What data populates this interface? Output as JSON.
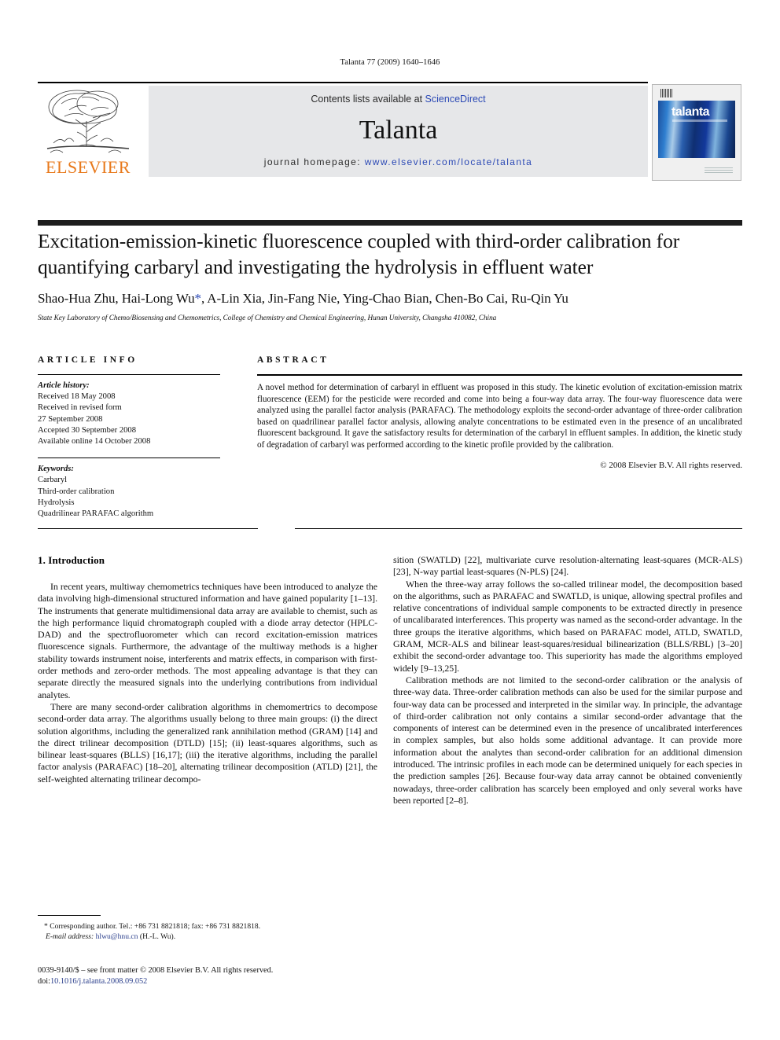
{
  "running_head": "Talanta 77 (2009) 1640–1646",
  "masthead": {
    "contents_prefix": "Contents lists available at ",
    "contents_link": "ScienceDirect",
    "journal_name": "Talanta",
    "homepage_prefix": "journal homepage: ",
    "homepage_link": "www.elsevier.com/locate/talanta",
    "publisher": "ELSEVIER",
    "cover_title": "talanta"
  },
  "article": {
    "title": "Excitation-emission-kinetic fluorescence coupled with third-order calibration for quantifying carbaryl and investigating the hydrolysis in effluent water",
    "authors": "Shao-Hua Zhu, Hai-Long Wu",
    "authors_rest": ", A-Lin Xia, Jin-Fang Nie, Ying-Chao Bian, Chen-Bo Cai, Ru-Qin Yu",
    "corresponding_marker": "*",
    "affiliation": "State Key Laboratory of Chemo/Biosensing and Chemometrics, College of Chemistry and Chemical Engineering, Hunan University, Changsha 410082, China"
  },
  "article_info": {
    "heading": "ARTICLE INFO",
    "history_label": "Article history:",
    "history": [
      "Received 18 May 2008",
      "Received in revised form",
      "27 September 2008",
      "Accepted 30 September 2008",
      "Available online 14 October 2008"
    ],
    "keywords_label": "Keywords:",
    "keywords": [
      "Carbaryl",
      "Third-order calibration",
      "Hydrolysis",
      "Quadrilinear PARAFAC algorithm"
    ]
  },
  "abstract": {
    "heading": "ABSTRACT",
    "text": "A novel method for determination of carbaryl in effluent was proposed in this study. The kinetic evolution of excitation-emission matrix fluorescence (EEM) for the pesticide were recorded and come into being a four-way data array. The four-way fluorescence data were analyzed using the parallel factor analysis (PARAFAC). The methodology exploits the second-order advantage of three-order calibration based on quadrilinear parallel factor analysis, allowing analyte concentrations to be estimated even in the presence of an uncalibrated fluorescent background. It gave the satisfactory results for determination of the carbaryl in effluent samples. In addition, the kinetic study of degradation of carbaryl was performed according to the kinetic profile provided by the calibration.",
    "copyright": "© 2008 Elsevier B.V. All rights reserved."
  },
  "body": {
    "section_number_title": "1. Introduction",
    "left_paragraphs": [
      "In recent years, multiway chemometrics techniques have been introduced to analyze the data involving high-dimensional structured information and have gained popularity [1–13]. The instruments that generate multidimensional data array are available to chemist, such as the high performance liquid chromatograph coupled with a diode array detector (HPLC-DAD) and the spectrofluorometer which can record excitation-emission matrices fluorescence signals. Furthermore, the advantage of the multiway methods is a higher stability towards instrument noise, interferents and matrix effects, in comparison with first-order methods and zero-order methods. The most appealing advantage is that they can separate directly the measured signals into the underlying contributions from individual analytes.",
      "There are many second-order calibration algorithms in chemomertrics to decompose second-order data array. The algorithms usually belong to three main groups: (i) the direct solution algorithms, including the generalized rank annihilation method (GRAM) [14] and the direct trilinear decomposition (DTLD) [15]; (ii) least-squares algorithms, such as bilinear least-squares (BLLS) [16,17]; (iii) the iterative algorithms, including the parallel factor analysis (PARAFAC) [18–20], alternating trilinear decomposition (ATLD) [21], the self-weighted alternating trilinear decompo-"
    ],
    "right_paragraphs": [
      "sition (SWATLD) [22], multivariate curve resolution-alternating least-squares (MCR-ALS) [23], N-way partial least-squares (N-PLS) [24].",
      "When the three-way array follows the so-called trilinear model, the decomposition based on the algorithms, such as PARAFAC and SWATLD, is unique, allowing spectral profiles and relative concentrations of individual sample components to be extracted directly in presence of uncalibarated interferences. This property was named as the second-order advantage. In the three groups the iterative algorithms, which based on PARAFAC model, ATLD, SWATLD, GRAM, MCR-ALS and bilinear least-squares/residual bilinearization (BLLS/RBL) [3–20] exhibit the second-order advantage too. This superiority has made the algorithms employed widely [9–13,25].",
      "Calibration methods are not limited to the second-order calibration or the analysis of three-way data. Three-order calibration methods can also be used for the similar purpose and four-way data can be processed and interpreted in the similar way. In principle, the advantage of third-order calibration not only contains a similar second-order advantage that the components of interest can be determined even in the presence of uncalibrated interferences in complex samples, but also holds some additional advantage. It can provide more information about the analytes than second-order calibration for an additional dimension introduced. The intrinsic profiles in each mode can be determined uniquely for each species in the prediction samples [26]. Because four-way data array cannot be obtained conveniently nowadays, three-order calibration has scarcely been employed and only several works have been reported [2–8]."
    ]
  },
  "footnote": {
    "marker": "*",
    "corresponding": "Corresponding author. Tel.: +86 731 8821818; fax: +86 731 8821818.",
    "email_label": "E-mail address:",
    "email": "hlwu@hnu.cn",
    "email_suffix": "(H.-L. Wu)."
  },
  "imprint": {
    "issn_line": "0039-9140/$ – see front matter © 2008 Elsevier B.V. All rights reserved.",
    "doi_label": "doi:",
    "doi": "10.1016/j.talanta.2008.09.052"
  },
  "colors": {
    "link": "#2b49b5",
    "reference": "#2b3f8c",
    "elsevier_orange": "#E8791B",
    "band_gray": "#e6e7e9"
  }
}
